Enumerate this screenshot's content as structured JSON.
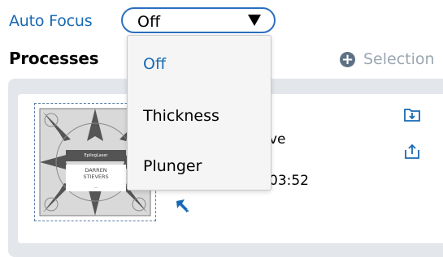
{
  "auto_focus": {
    "label": "Auto Focus",
    "selected": "Off",
    "options": [
      "Off",
      "Thickness",
      "Plunger"
    ]
  },
  "processes": {
    "title": "Processes",
    "selection_label": "Selection"
  },
  "job": {
    "thumbnail": {
      "brand": "EpilogLaser",
      "name_line1": "DARREN",
      "name_line2": "STIEVERS",
      "subline": "—"
    },
    "name_partial": "ve",
    "time_partial": "03:52"
  },
  "colors": {
    "accent": "#1769b5",
    "panel": "#e3e6ea",
    "muted": "#9aa6b2"
  }
}
